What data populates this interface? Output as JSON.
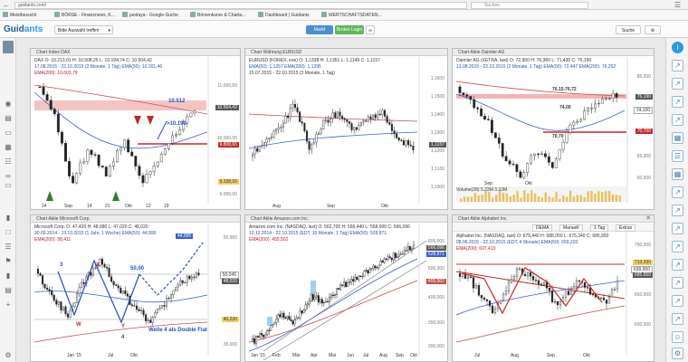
{
  "browser": {
    "url": "guidants.com/",
    "search_placeholder": "Suchen",
    "bookmarks": [
      "Meistbesucht",
      "BÖRSE - Finanznews, K...",
      "jandaya - Google-Suche",
      "Börsenkurse & Charta...",
      "Dashboard | Guidants",
      "WERTSCHAFTSDATEN..."
    ]
  },
  "app": {
    "logo_main": "Guid",
    "logo_accent": "ants",
    "select_label": "Bitte Auswahl treffen",
    "market_btn": "Markt",
    "broker_btn": "Broker Login",
    "search_btn": "Suche"
  },
  "colors": {
    "accent": "#2b9be0",
    "red": "#c62828",
    "blue": "#1f4fbf",
    "green": "#2e7d32",
    "ema50": "#3a5fcd",
    "ema200": "#c0504d"
  },
  "charts": {
    "c1": {
      "window_title": "Chart Index DAX",
      "l1": "DAX  O: 10.213,01  H: 10.508,25  L: 10.194,74  C: 10.504,42",
      "l2": "17.08.2015 - 22.10.2015 (2 Monate, 1 Tag)  EMA(50): 10.201,46",
      "l3": "EMA(200): 10.603,79",
      "price_tags": [
        "11.000,00",
        "10.504,42",
        "10.000,00",
        "9.808,65",
        "9.338,20",
        "9.000,00"
      ],
      "xticks": [
        "24",
        "Sep",
        "14",
        "21",
        "Okt",
        "12",
        "19"
      ],
      "ann_a": "10.512",
      "ann_b": ">10.190"
    },
    "c2": {
      "window_title": "Chart Währung EURUSD",
      "l1": "EURUSD (FOREX, exe)  O: 1,1338  H: 1,1351  L: 1,1149  C: 1,1157",
      "l2": "EMA(50): 1,1257  EMA(200): 1,1395",
      "l3": "15.07.2015 - 22.10.2015 (3 Monate, 1 Tag)",
      "price_tags": [
        "1,1600",
        "1,1500",
        "1,1400",
        "1,1300",
        "1,1200",
        "1,1157",
        "1,1100",
        "1,1000"
      ],
      "xticks": [
        "Aug",
        "Sep",
        "Okt"
      ]
    },
    "c3": {
      "window_title": "Chart Aktie Daimler AG",
      "l1": "Daimler AG (XETRA, last)  O: 72,900  H: 76,360  L: 71,430  C: 76,190",
      "l2": "13.08.2015 - 22.10.2015 (2 Monate, 1 Tag)  EMA(50): 72,447  EMA(200): 76,252",
      "price_tags": [
        "85,000",
        "76,190",
        "74,100",
        "70,700",
        "65,000",
        "60,000"
      ],
      "xticks": [
        "Sep",
        "Okt"
      ],
      "ann_a": "76,15-76,72",
      "ann_b": "74,00",
      "ann_c": "70,70",
      "volume": "Volume(28) 5.23M  3.33M"
    },
    "c4": {
      "window_title": "Chart Aktie Microsoft Corp.",
      "l1": "Microsoft Corp.  O: 47,420  H: 48,680  L: 47,020  C: 48,020",
      "l2": "30.09.2014 - 19.10.2015 (1 Jahr, 1 Woche)  EMA(50): 44,890",
      "l3": "EMA(200): 38,411",
      "price_tags": [
        "55,000",
        "50,045",
        "48,020",
        "44,890",
        "40,230",
        "35,000"
      ],
      "xticks": [
        "Jan '15",
        "Jul",
        "Okt"
      ],
      "wave_labels": [
        "3",
        "X",
        "W",
        "Y",
        "4",
        "50,00"
      ],
      "ann": "Welle 4 als Double Flat"
    },
    "c5": {
      "window_title": "Chart Aktie Amazon.com Inc.",
      "l1": "Amazon.com Inc. (NASDAQ, last)  O: 562,700  H: 566,440  L: 558,000  C: 566,096",
      "l2": "10.12.2014 - 22.10.2015 (EDT, 10 Monate, 1 Tag)  EMA(50): 528,871",
      "l3": "EMA(200): 455,502",
      "price_tags": [
        "600,000",
        "566,096",
        "528,871",
        "500,000",
        "455,502",
        "400,000",
        "350,000",
        "300,000"
      ],
      "xticks": [
        "Jan '15",
        "Feb",
        "Mär",
        "Apr",
        "Mai",
        "Jun",
        "Jul",
        "Aug",
        "Sep",
        "Okt"
      ]
    },
    "c6": {
      "window_title": "Chart Aktie Alphabet Inc.",
      "toolbar": [
        "DEMA",
        "Manuell",
        "1 Tag",
        "Extras"
      ],
      "l1": "Alphabet Inc. (NASDAQ, last)  O: 675,440  H: 688,050  L: 675,340  C: 685,650",
      "l2": "08.06.2015 - 22.10.2015 (EDT, 4 Monate)  EMA(50): 659,203",
      "l3": "EMA(200): 607,410",
      "price_tags": [
        "750,000",
        "713,330",
        "699,950",
        "685,650",
        "650,000",
        "600,000"
      ],
      "xticks": [
        "Jul",
        "Aug",
        "Sep",
        "Okt"
      ]
    }
  }
}
